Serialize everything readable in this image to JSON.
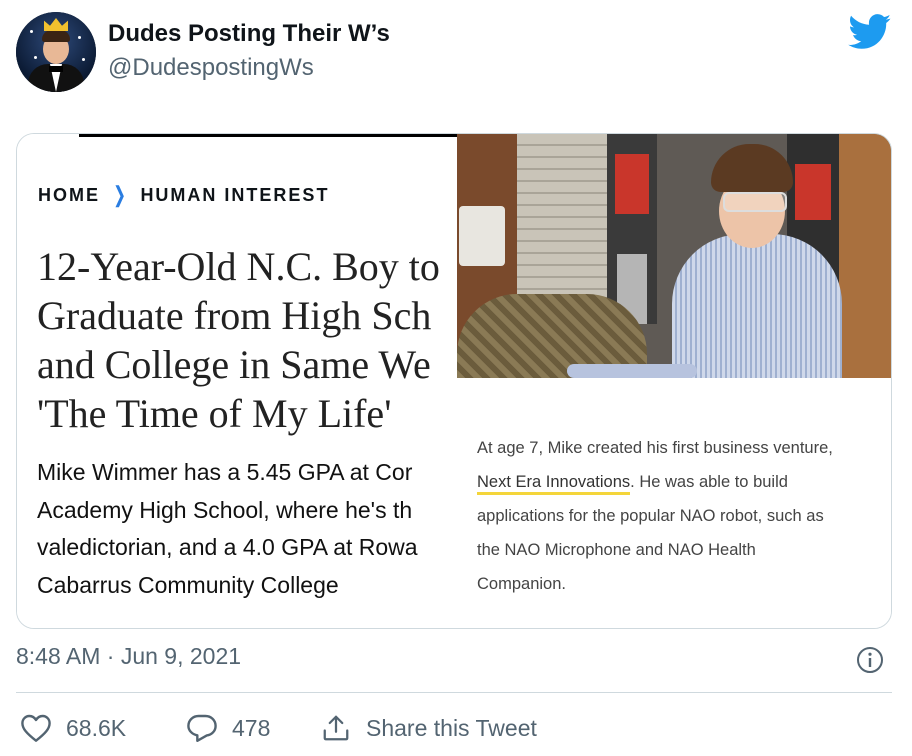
{
  "tweet": {
    "display_name": "Dudes Posting Their W’s",
    "handle": "@DudespostingWs",
    "timestamp": "8:48 AM · Jun 9, 2021"
  },
  "article": {
    "breadcrumb_home": "HOME",
    "breadcrumb_section": "HUMAN INTEREST",
    "headline_lines": [
      "12-Year-Old N.C. Boy to",
      "Graduate from High Sch",
      "and College in Same We",
      "'The Time of My Life'"
    ],
    "summary_lines": [
      "Mike Wimmer has a 5.45 GPA at Cor",
      "Academy High School, where he's th",
      "valedictorian, and a 4.0 GPA at Rowa",
      "Cabarrus Community College"
    ]
  },
  "caption": {
    "line1": "At age 7, Mike created his first business venture,",
    "link": "Next Era Innovations",
    "line2_rest": ". He was able to build",
    "line3": "applications for the popular NAO robot, such as",
    "line4": "the NAO Microphone and NAO Health",
    "line5": "Companion."
  },
  "actions": {
    "likes": "68.6K",
    "replies": "478",
    "share": "Share this Tweet"
  },
  "colors": {
    "twitter_blue": "#1d9bf0",
    "secondary_text": "#536471",
    "link_underline": "#f4d53a"
  },
  "icons": [
    "twitter-bird-icon",
    "chevron-right-icon",
    "info-icon",
    "heart-icon",
    "reply-icon",
    "share-icon"
  ]
}
